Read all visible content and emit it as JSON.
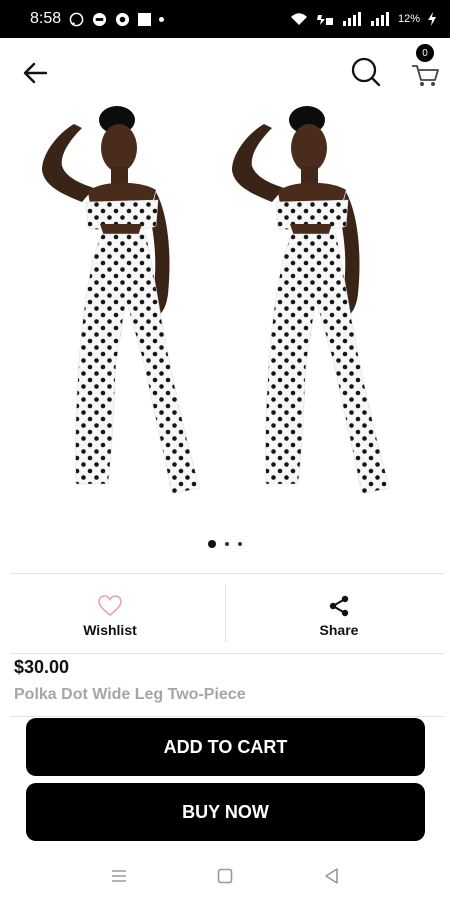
{
  "status_bar": {
    "time": "8:58",
    "battery": "12%",
    "icons": [
      "whatsapp-icon",
      "message-icon",
      "record-icon",
      "image-icon",
      "dot-icon",
      "wifi-icon",
      "volte-icon",
      "signal-icon",
      "signal-icon",
      "charging-icon"
    ]
  },
  "app_bar": {
    "back_icon": "arrow-left-icon",
    "search_icon": "search-icon",
    "cart_icon": "cart-icon",
    "cart_count": "0"
  },
  "gallery": {
    "image": "polka-dot-two-piece-model-image",
    "pages": 3,
    "current_page": 1
  },
  "actions": {
    "wishlist_label": "Wishlist",
    "wishlist_icon": "heart-outline-icon",
    "share_label": "Share",
    "share_icon": "share-icon"
  },
  "product": {
    "price": "$30.00",
    "title": "Polka Dot Wide Leg Two-Piece"
  },
  "buttons": {
    "add_to_cart": "ADD TO CART",
    "buy_now": "BUY NOW"
  },
  "nav_bar": {
    "icons": [
      "menu-icon",
      "home-square-icon",
      "back-triangle-icon"
    ]
  },
  "colors": {
    "primary_button": "#000000",
    "heart_outline": "#e6a3b0",
    "title_grey": "#a6a6a6"
  }
}
